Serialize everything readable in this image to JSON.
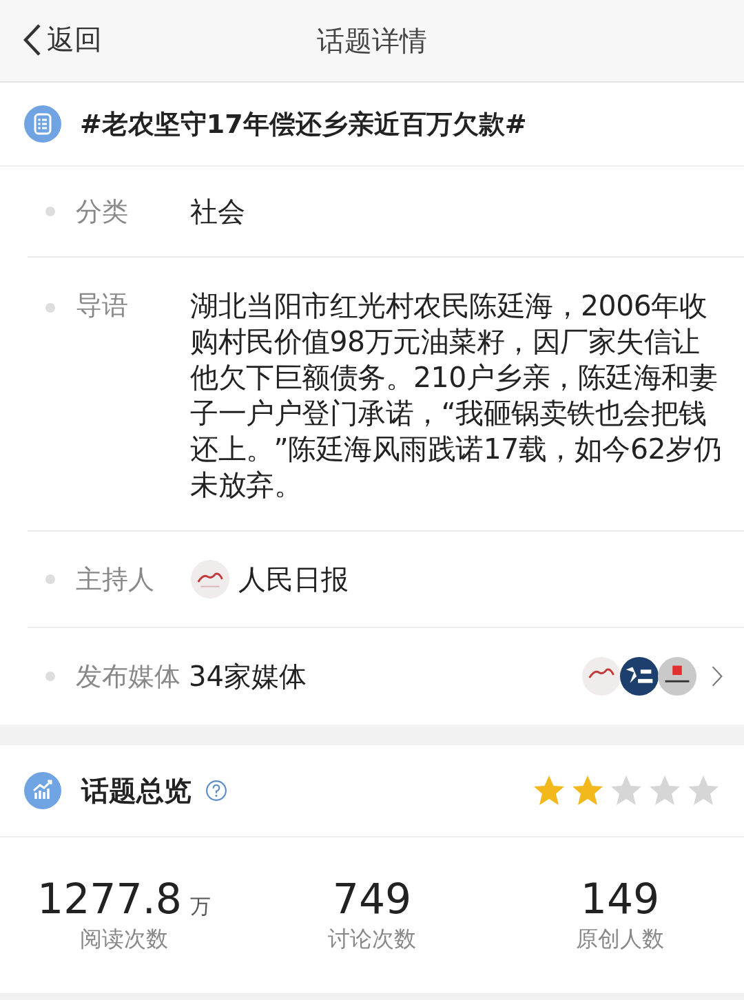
{
  "nav": {
    "back_label": "返回",
    "title": "话题详情"
  },
  "topic": {
    "title": "#老农坚守17年偿还乡亲近百万欠款#"
  },
  "details": [
    {
      "kind": "text",
      "label": "分类",
      "value": "社会"
    },
    {
      "kind": "text",
      "label": "导语",
      "value": "湖北当阳市红光村农民陈廷海，2006年收购村民价值98万元油菜籽，因厂家失信让他欠下巨额债务。210户乡亲，陈廷海和妻子一户户登门承诺，“我砸锅卖铁也会把钱还上。”陈廷海风雨践诺17载，如今62岁仍未放弃。"
    },
    {
      "kind": "host",
      "label": "主持人",
      "value": "人民日报"
    },
    {
      "kind": "media",
      "label": "发布媒体",
      "value": "34家媒体"
    }
  ],
  "overview": {
    "title": "话题总览",
    "stars": 2,
    "stats": [
      {
        "value": "1277.8",
        "unit": "万",
        "label": "阅读次数"
      },
      {
        "value": "749",
        "label": "讨论次数"
      },
      {
        "value": "149",
        "label": "原创人数"
      }
    ]
  }
}
